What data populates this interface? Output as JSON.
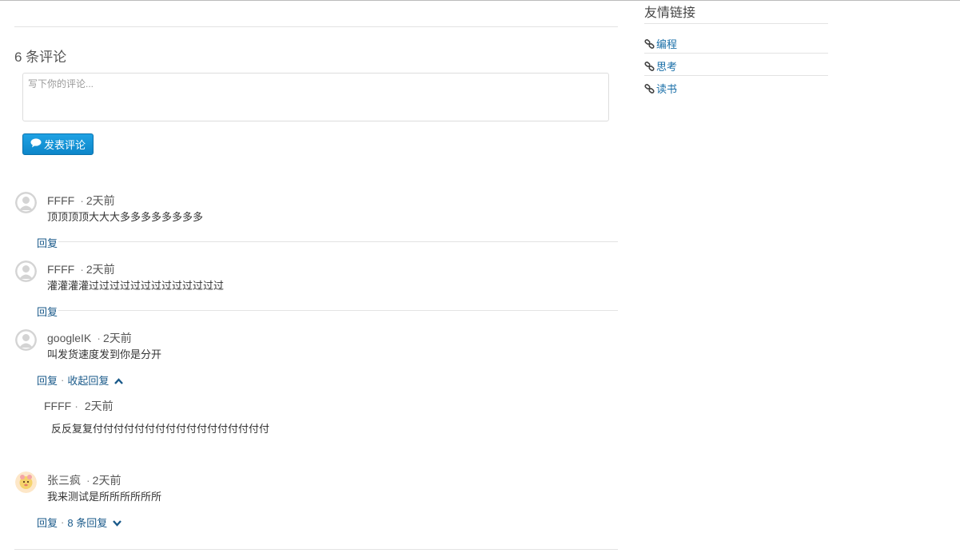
{
  "comments_section": {
    "count_title": "6 条评论",
    "textarea_placeholder": "写下你的评论...",
    "submit_label": "发表评论"
  },
  "comments": [
    {
      "author": "FFFF",
      "time": "2天前",
      "text": "顶顶顶顶大大大多多多多多多多多",
      "reply_label": "回复"
    },
    {
      "author": "FFFF",
      "time": "2天前",
      "text": "灌灌灌灌过过过过过过过过过过过过过",
      "reply_label": "回复"
    },
    {
      "author": "googleIK",
      "time": "2天前",
      "text": "叫发货速度发到你是分开",
      "reply_label": "回复",
      "toggle_label": "收起回复",
      "sub_reply": {
        "author": "FFFF",
        "time": "2天前",
        "text": "反反复复付付付付付付付付付付付付付付付付付"
      }
    },
    {
      "author": "张三疯",
      "time": "2天前",
      "text": "我来测试是所所所所所所",
      "reply_label": "回复",
      "toggle_label": "8 条回复"
    }
  ],
  "sidebar": {
    "title": "友情链接",
    "links": [
      "编程",
      "思考",
      "读书"
    ]
  },
  "colors": {
    "accent": "#0d86c9",
    "link": "#1a6fa8"
  },
  "icons": {
    "comment": "comment-bubble-icon",
    "link": "link-chain-icon",
    "avatar": "default-avatar-icon"
  }
}
